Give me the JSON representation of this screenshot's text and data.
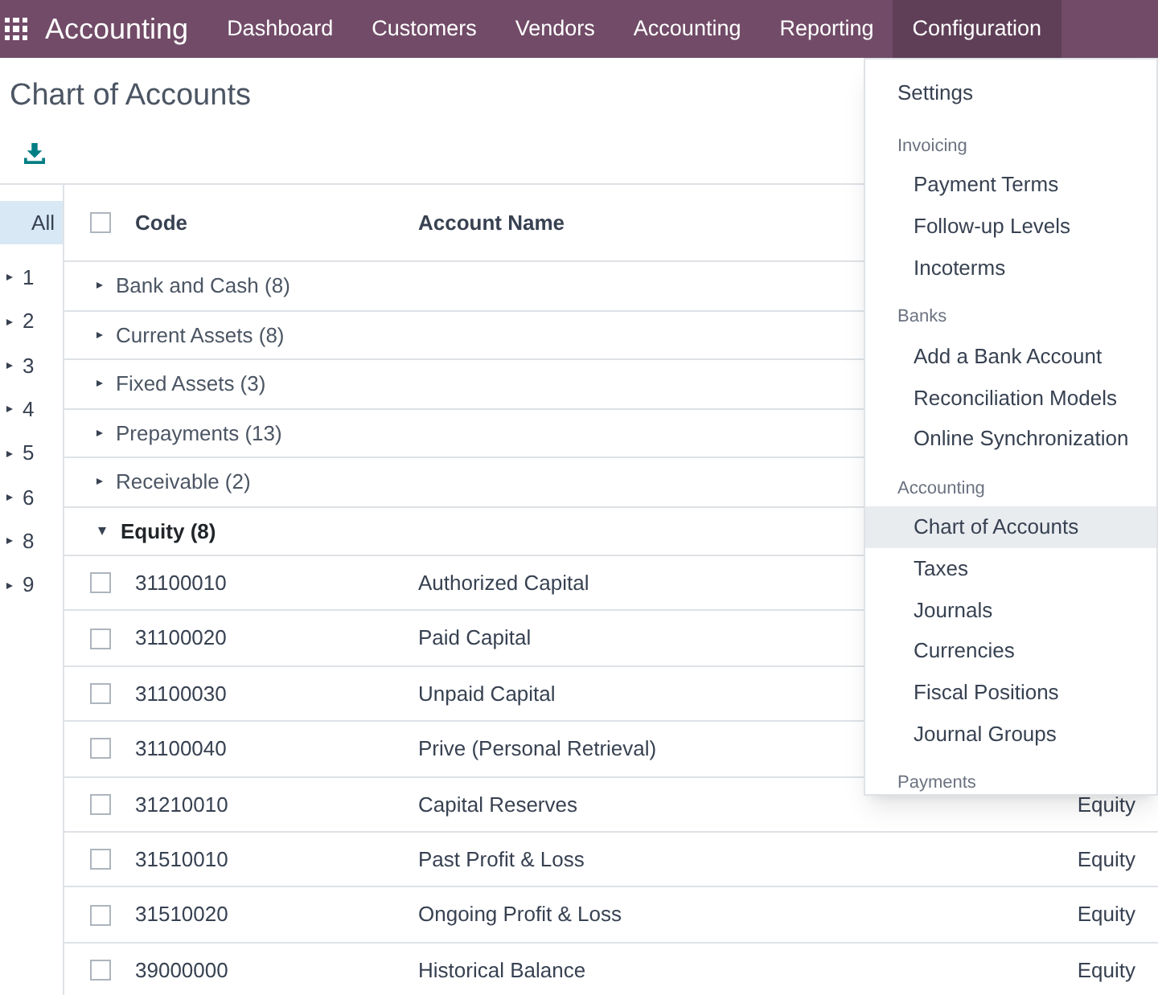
{
  "navbar": {
    "app_title": "Accounting",
    "menu": [
      {
        "label": "Dashboard",
        "selected": false
      },
      {
        "label": "Customers",
        "selected": false
      },
      {
        "label": "Vendors",
        "selected": false
      },
      {
        "label": "Accounting",
        "selected": false
      },
      {
        "label": "Reporting",
        "selected": false
      },
      {
        "label": "Configuration",
        "selected": true
      }
    ]
  },
  "page_title": "Chart of Accounts",
  "sidebar": {
    "items": [
      {
        "label": "All",
        "kind": "all",
        "selected": true
      },
      {
        "label": "1",
        "kind": "group",
        "selected": false,
        "expanded": false
      },
      {
        "label": "2",
        "kind": "group",
        "selected": false,
        "expanded": false
      },
      {
        "label": "3",
        "kind": "group",
        "selected": false,
        "expanded": false
      },
      {
        "label": "4",
        "kind": "group",
        "selected": false,
        "expanded": false
      },
      {
        "label": "5",
        "kind": "group",
        "selected": false,
        "expanded": false
      },
      {
        "label": "6",
        "kind": "group",
        "selected": false,
        "expanded": false
      },
      {
        "label": "8",
        "kind": "group",
        "selected": false,
        "expanded": false
      },
      {
        "label": "9",
        "kind": "group",
        "selected": false,
        "expanded": false
      }
    ]
  },
  "table": {
    "select_all_checked": false,
    "columns": [
      "Code",
      "Account Name"
    ],
    "groups": [
      {
        "label": "Bank and Cash (8)",
        "expanded": false
      },
      {
        "label": "Current Assets (8)",
        "expanded": false
      },
      {
        "label": "Fixed Assets (3)",
        "expanded": false
      },
      {
        "label": "Prepayments (13)",
        "expanded": false
      },
      {
        "label": "Receivable (2)",
        "expanded": false
      },
      {
        "label": "Equity (8)",
        "expanded": true,
        "rows": [
          {
            "code": "31100010",
            "name": "Authorized Capital",
            "checked": false
          },
          {
            "code": "31100020",
            "name": "Paid Capital",
            "checked": false
          },
          {
            "code": "31100030",
            "name": "Unpaid Capital",
            "checked": false
          },
          {
            "code": "31100040",
            "name": "Prive (Personal Retrieval)",
            "checked": false
          },
          {
            "code": "31210010",
            "name": "Capital Reserves",
            "type": "Equity",
            "checked": false
          },
          {
            "code": "31510010",
            "name": "Past Profit & Loss",
            "type": "Equity",
            "checked": false
          },
          {
            "code": "31510020",
            "name": "Ongoing Profit & Loss",
            "type": "Equity",
            "checked": false
          },
          {
            "code": "39000000",
            "name": "Historical Balance",
            "type": "Equity",
            "checked": false
          }
        ]
      }
    ]
  },
  "dropdown": {
    "entries": [
      {
        "kind": "item",
        "label": "Settings",
        "selected": false
      },
      {
        "kind": "header",
        "label": "Invoicing"
      },
      {
        "kind": "subitem",
        "label": "Payment Terms",
        "selected": false
      },
      {
        "kind": "subitem",
        "label": "Follow-up Levels",
        "selected": false
      },
      {
        "kind": "subitem",
        "label": "Incoterms",
        "selected": false
      },
      {
        "kind": "header",
        "label": "Banks"
      },
      {
        "kind": "subitem",
        "label": "Add a Bank Account",
        "selected": false
      },
      {
        "kind": "subitem",
        "label": "Reconciliation Models",
        "selected": false
      },
      {
        "kind": "subitem",
        "label": "Online Synchronization",
        "selected": false
      },
      {
        "kind": "header",
        "label": "Accounting"
      },
      {
        "kind": "subitem",
        "label": "Chart of Accounts",
        "selected": true
      },
      {
        "kind": "subitem",
        "label": "Taxes",
        "selected": false
      },
      {
        "kind": "subitem",
        "label": "Journals",
        "selected": false
      },
      {
        "kind": "subitem",
        "label": "Currencies",
        "selected": false
      },
      {
        "kind": "subitem",
        "label": "Fiscal Positions",
        "selected": false
      },
      {
        "kind": "subitem",
        "label": "Journal Groups",
        "selected": false
      },
      {
        "kind": "header",
        "label": "Payments"
      }
    ]
  }
}
